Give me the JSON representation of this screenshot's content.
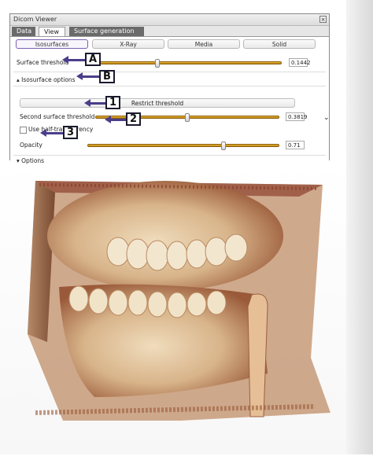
{
  "window": {
    "title": "Dicom Viewer",
    "close_glyph": "×",
    "tabs": [
      {
        "label": "Data",
        "active": false
      },
      {
        "label": "View",
        "active": true
      },
      {
        "label": "Surface generation",
        "active": false
      }
    ]
  },
  "render_modes": [
    {
      "label": "Isosurfaces",
      "selected": true
    },
    {
      "label": "X-Ray",
      "selected": false
    },
    {
      "label": "Media",
      "selected": false
    },
    {
      "label": "Solid",
      "selected": false
    }
  ],
  "surface_threshold": {
    "label": "Surface threshold",
    "value": "0.1442",
    "level": 0.36
  },
  "isosurface_options": {
    "label": "Isosurface options",
    "expanded": true,
    "expander_glyph": "▴"
  },
  "restrict_threshold_label": "Restrict threshold",
  "second_surface_threshold": {
    "label": "Second surface threshold",
    "value": "0.3819",
    "level": 0.5
  },
  "half_transparency": {
    "label": "Use half-transparency",
    "checked": false
  },
  "opacity": {
    "label": "Opacity",
    "value": "0.71",
    "level": 0.71
  },
  "options": {
    "label": "Options",
    "expanded": false,
    "expander_glyph": "▾"
  },
  "annotations": [
    "A",
    "B",
    "1",
    "2",
    "3"
  ],
  "viewport": {
    "content": "3D isosurface rendering of jaw and teeth"
  },
  "colors": {
    "accent": "#4a3e8a",
    "slider": "#d4a020",
    "render_bone": "#e8cfa8",
    "render_edge": "#8a3f2a"
  },
  "icons": {
    "scroll": "chevron-down-icon",
    "close": "close-icon"
  }
}
